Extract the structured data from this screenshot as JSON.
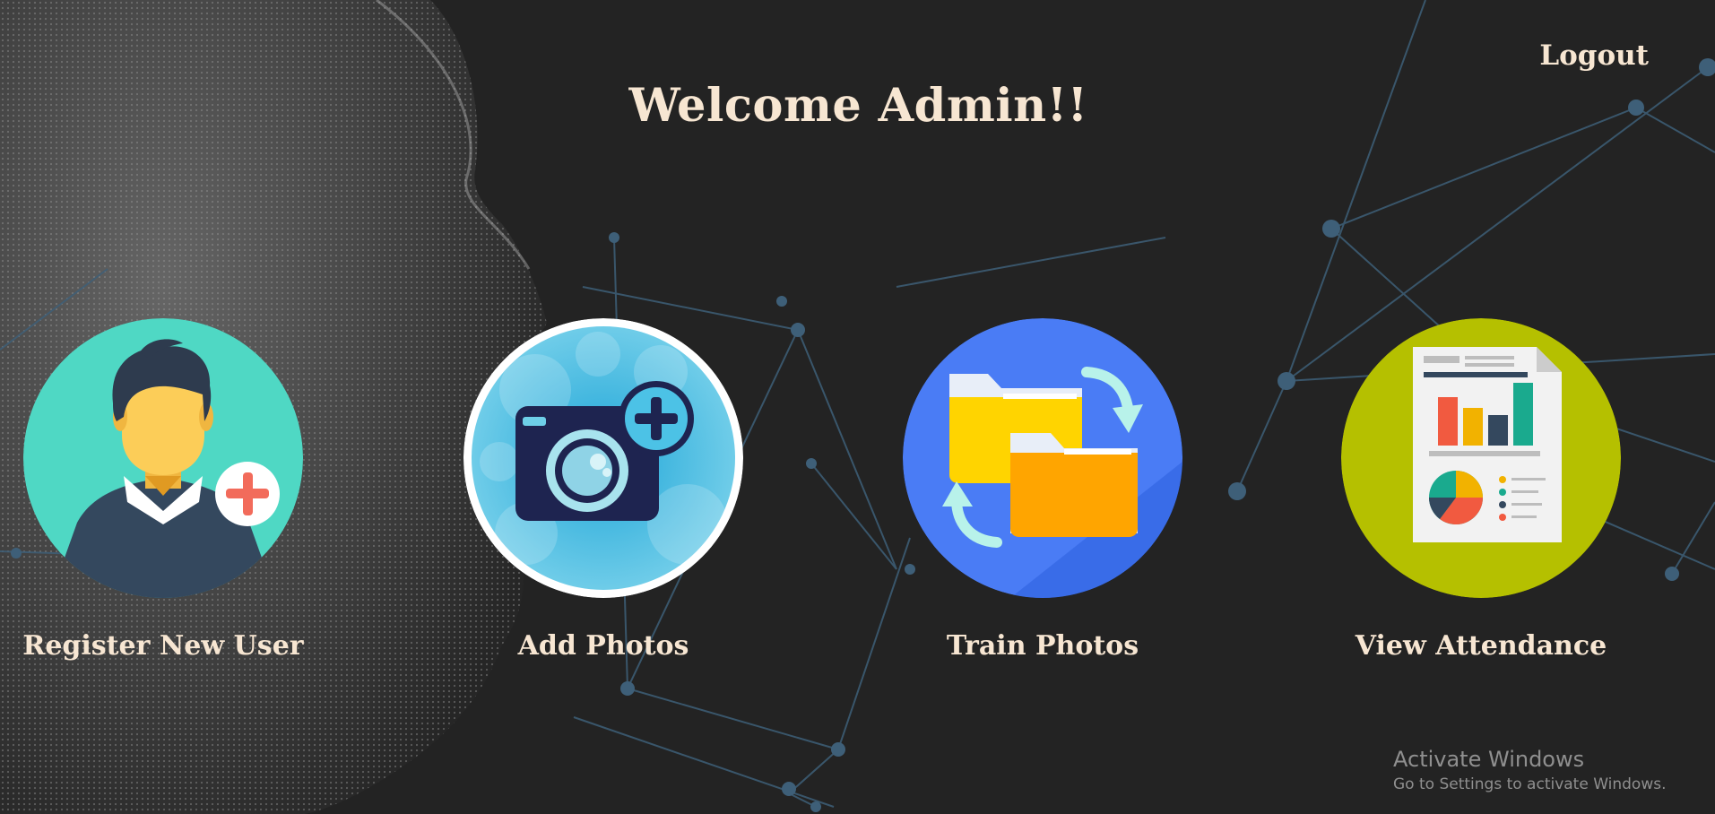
{
  "header": {
    "title": "Welcome Admin!!",
    "logout_label": "Logout"
  },
  "tiles": [
    {
      "label": "Register New User",
      "icon": "register-user-icon",
      "color": "#4fd8c4"
    },
    {
      "label": "Add Photos",
      "icon": "add-photo-camera-icon",
      "color": "#5bc8e8"
    },
    {
      "label": "Train Photos",
      "icon": "train-folders-icon",
      "color": "#4a7cf5"
    },
    {
      "label": "View Attendance",
      "icon": "attendance-report-icon",
      "color": "#b5c000"
    }
  ],
  "watermark": {
    "title": "Activate Windows",
    "subtitle": "Go to Settings to activate Windows."
  },
  "colors": {
    "background": "#232323",
    "text": "#f7e6d2",
    "network_lines": "#3e5f78"
  }
}
